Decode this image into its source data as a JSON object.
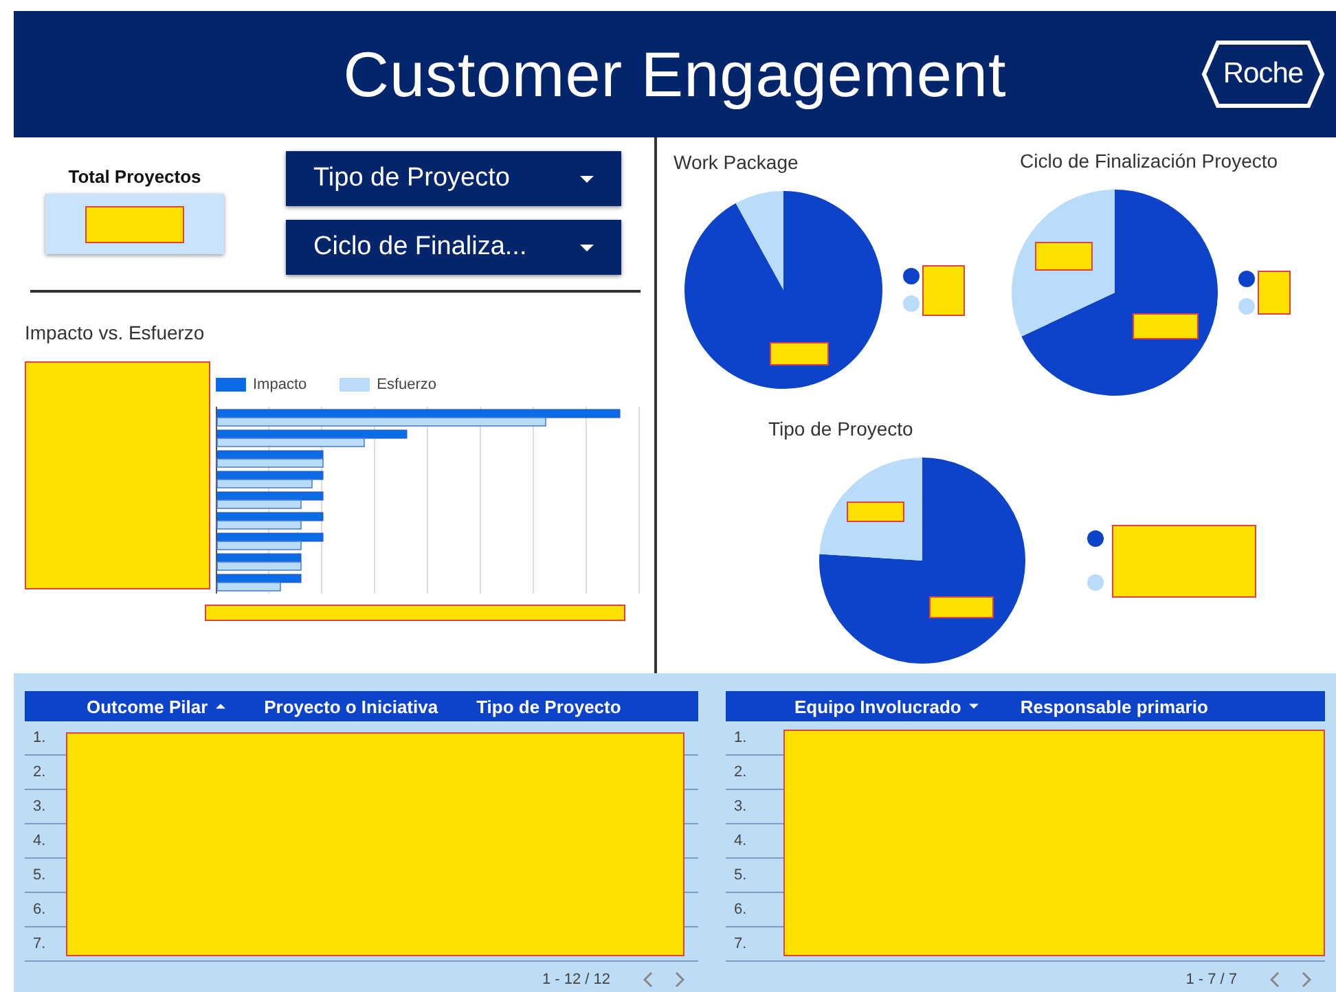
{
  "header": {
    "title": "Customer Engagement",
    "logo": "Roche"
  },
  "total": {
    "label": "Total Proyectos"
  },
  "filters": [
    {
      "label": "Tipo de Proyecto"
    },
    {
      "label": "Ciclo de Finaliza..."
    }
  ],
  "bar_chart": {
    "title": "Impacto vs. Esfuerzo",
    "legend": [
      {
        "label": "Impacto",
        "color": "#0b6ce6"
      },
      {
        "label": "Esfuerzo",
        "color": "#b9dcfb"
      }
    ]
  },
  "pies": [
    {
      "title": "Work Package",
      "legend": [
        {
          "color": "#0d43c9"
        },
        {
          "color": "#b9dcfb"
        }
      ]
    },
    {
      "title": "Ciclo de Finalización Proyecto",
      "legend": [
        {
          "color": "#0d43c9"
        },
        {
          "color": "#b9dcfb"
        }
      ]
    },
    {
      "title": "Tipo de Proyecto",
      "legend": [
        {
          "color": "#0d43c9"
        },
        {
          "color": "#b9dcfb"
        }
      ]
    }
  ],
  "tables": [
    {
      "columns": [
        {
          "label": "Outcome Pilar",
          "sort_ascending": true,
          "sort_descending": false
        },
        {
          "label": "Proyecto o Iniciativa",
          "sort_ascending": false,
          "sort_descending": false
        },
        {
          "label": "Tipo de Proyecto",
          "sort_ascending": false,
          "sort_descending": false
        }
      ],
      "row_numbers": [
        "1.",
        "2.",
        "3.",
        "4.",
        "5.",
        "6.",
        "7."
      ],
      "pagination": "1 - 12 / 12"
    },
    {
      "columns": [
        {
          "label": "Equipo Involucrado",
          "sort_ascending": false,
          "sort_descending": true
        },
        {
          "label": "Responsable primario",
          "sort_ascending": false,
          "sort_descending": false
        }
      ],
      "row_numbers": [
        "1.",
        "2.",
        "3.",
        "4.",
        "5.",
        "6.",
        "7."
      ],
      "pagination": "1 - 7 / 7"
    }
  ]
}
